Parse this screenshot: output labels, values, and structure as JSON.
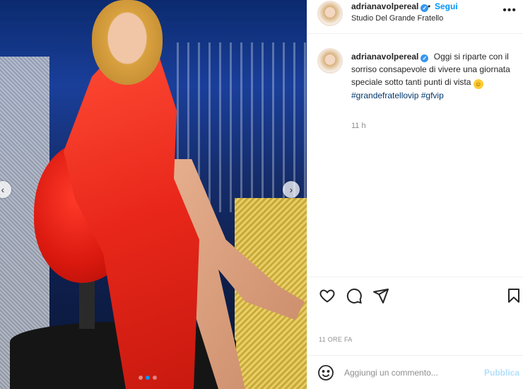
{
  "post": {
    "username": "adrianavolpereal",
    "follow_label": "Segui",
    "separator": "•",
    "location": "Studio Del Grande Fratello",
    "more_label": "•••",
    "caption_text": "Oggi si riparte con il sorriso consapevole di vivere una giornata speciale sotto tanti punti di vista",
    "hashtag_1": "#grandefratellovip",
    "hashtag_2": "#gfvip",
    "time_ago": "11 h",
    "date_label": "11 ORE FA"
  },
  "carousel": {
    "prev_label": "‹",
    "next_label": "›",
    "dot_count": 3,
    "active_index": 1
  },
  "actions": {
    "icons": [
      "heart-icon",
      "comment-icon",
      "share-icon",
      "bookmark-icon"
    ]
  },
  "comment": {
    "placeholder": "Aggiungi un commento...",
    "publish_label": "Pubblica"
  },
  "colors": {
    "accent": "#0095f6",
    "publish_disabled": "#b2dffc",
    "dress_red": "#e8271a"
  }
}
